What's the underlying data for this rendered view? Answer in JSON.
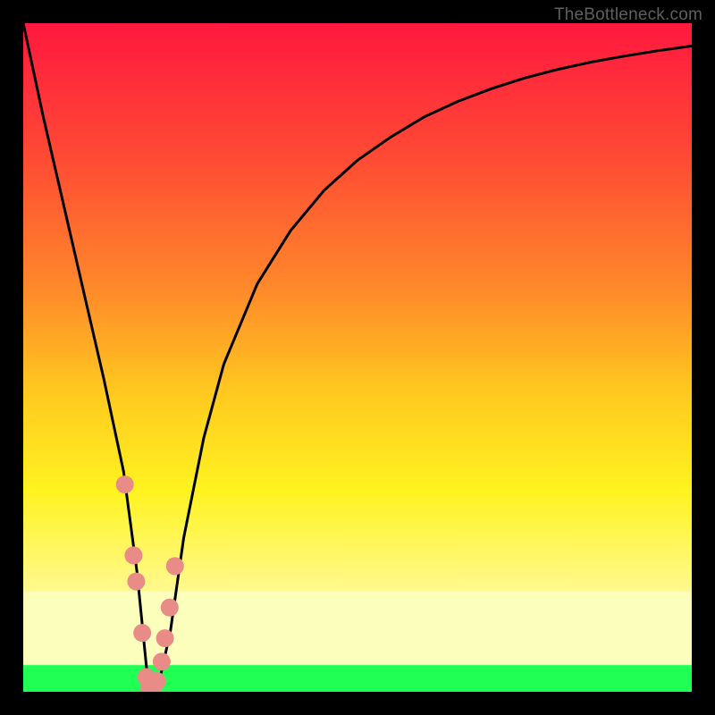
{
  "attribution": "TheBottleneck.com",
  "chart_data": {
    "type": "line",
    "title": "",
    "xlabel": "",
    "ylabel": "",
    "x_range": [
      0,
      100
    ],
    "y_range": [
      0,
      100
    ],
    "curve": {
      "name": "bottleneck-curve",
      "x": [
        0,
        3,
        6,
        9,
        12,
        15,
        17,
        18.5,
        20,
        22,
        24,
        27,
        30,
        35,
        40,
        45,
        50,
        55,
        60,
        65,
        70,
        75,
        80,
        85,
        90,
        95,
        100
      ],
      "y": [
        100,
        86,
        73,
        60,
        47,
        33,
        18,
        3,
        0,
        9,
        23,
        38,
        49,
        61,
        69,
        75,
        79.5,
        83,
        86,
        88.3,
        90.2,
        91.8,
        93.1,
        94.2,
        95.1,
        95.9,
        96.6
      ]
    },
    "markers": {
      "name": "highlighted-points",
      "x": [
        15.2,
        16.5,
        16.9,
        17.8,
        18.4,
        18.8,
        19.5,
        20.0,
        20.7,
        21.2,
        21.9,
        22.7
      ],
      "y": [
        31.0,
        20.4,
        16.5,
        8.8,
        2.2,
        0.6,
        0.9,
        1.6,
        4.5,
        8.0,
        12.6,
        18.8
      ]
    },
    "bands": [
      {
        "name": "green-bottom",
        "y0": 0,
        "y1": 4,
        "color": "#1fff54"
      },
      {
        "name": "pale-yellow",
        "y0": 4,
        "y1": 15,
        "color": "#fbffb0"
      }
    ],
    "gradient_stops": [
      {
        "pct": 0,
        "color": "#ff183f"
      },
      {
        "pct": 20,
        "color": "#ff4a34"
      },
      {
        "pct": 40,
        "color": "#ff8a2a"
      },
      {
        "pct": 55,
        "color": "#ffc81f"
      },
      {
        "pct": 70,
        "color": "#fff320"
      },
      {
        "pct": 100,
        "color": "#ffffff"
      }
    ],
    "frame_color": "#000000",
    "frame_thickness": 26,
    "marker_color": "#e98b86",
    "marker_radius": 10
  }
}
